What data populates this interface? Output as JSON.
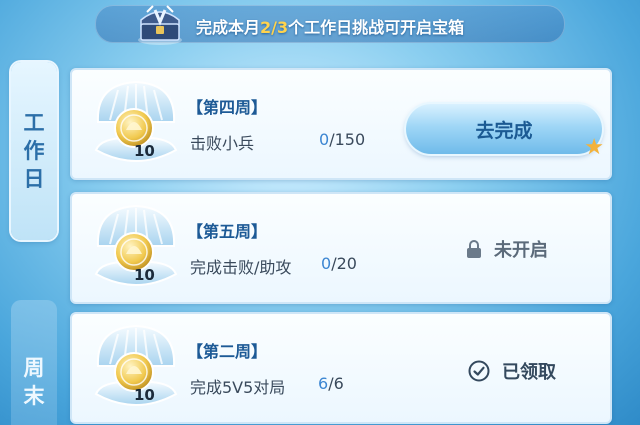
{
  "banner": {
    "text_before": "完成本月",
    "count": "2/3",
    "text_after": "个工作日挑战可开启宝箱"
  },
  "tabs": {
    "weekday": [
      "工",
      "作",
      "日"
    ],
    "weekend": [
      "周",
      "末"
    ]
  },
  "tasks": [
    {
      "week": "【第四周】",
      "task": "击败小兵",
      "progress_current": "0",
      "progress_total": "/150",
      "reward": "10",
      "action_label": "去完成"
    },
    {
      "week": "【第五周】",
      "task": "完成击败/助攻",
      "progress_current": "0",
      "progress_total": "/20",
      "reward": "10",
      "status_label": "未开启",
      "status_icon": "lock-icon"
    },
    {
      "week": "【第二周】",
      "task": "完成5V5对局",
      "progress_current": "6",
      "progress_total": "/6",
      "reward": "10",
      "status_label": "已领取",
      "status_icon": "check-circle-icon"
    }
  ],
  "colors": {
    "accent_text": "#1d5a96",
    "highlight": "#ffd34d",
    "progress_current": "#3c86d2"
  }
}
